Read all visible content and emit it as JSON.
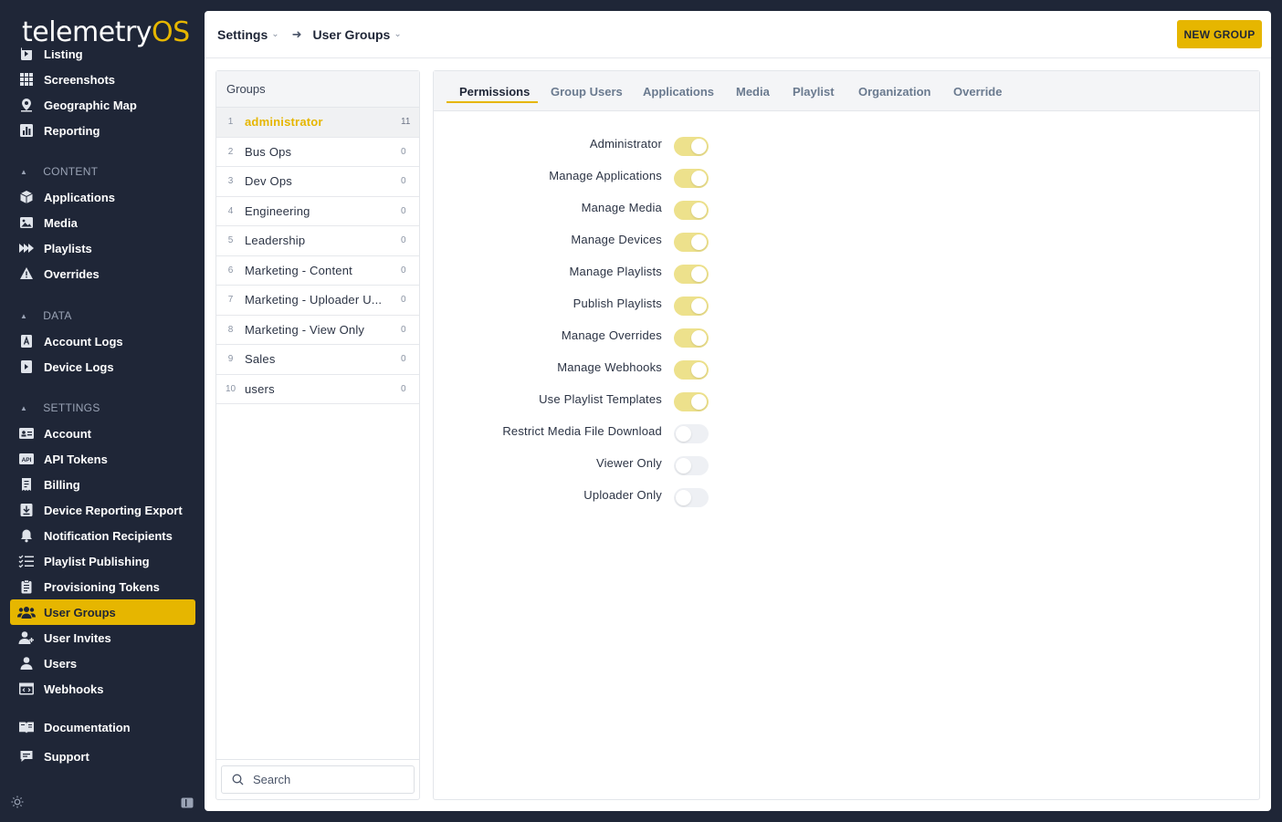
{
  "logo": {
    "text": "telemetry",
    "os": "OS"
  },
  "sidebar": {
    "partial_item": "Listing",
    "top_items": [
      {
        "label": "Screenshots",
        "icon": "grid-icon"
      },
      {
        "label": "Geographic Map",
        "icon": "map-pin-icon"
      },
      {
        "label": "Reporting",
        "icon": "chart-icon"
      }
    ],
    "sections": {
      "content": "CONTENT",
      "data": "DATA",
      "settings": "SETTINGS"
    },
    "content_items": [
      {
        "label": "Applications",
        "icon": "box-icon"
      },
      {
        "label": "Media",
        "icon": "image-icon"
      },
      {
        "label": "Playlists",
        "icon": "playlist-icon"
      },
      {
        "label": "Overrides",
        "icon": "warning-icon"
      }
    ],
    "data_items": [
      {
        "label": "Account Logs",
        "icon": "account-log-icon"
      },
      {
        "label": "Device Logs",
        "icon": "device-log-icon"
      }
    ],
    "settings_items": [
      {
        "label": "Account",
        "icon": "id-card-icon"
      },
      {
        "label": "API Tokens",
        "icon": "api-icon"
      },
      {
        "label": "Billing",
        "icon": "receipt-icon"
      },
      {
        "label": "Device Reporting Export",
        "icon": "download-icon"
      },
      {
        "label": "Notification Recipients",
        "icon": "bell-icon"
      },
      {
        "label": "Playlist Publishing",
        "icon": "checklist-icon"
      },
      {
        "label": "Provisioning Tokens",
        "icon": "clipboard-icon"
      },
      {
        "label": "User Groups",
        "icon": "users-icon"
      },
      {
        "label": "User Invites",
        "icon": "user-plus-icon"
      },
      {
        "label": "Users",
        "icon": "user-icon"
      },
      {
        "label": "Webhooks",
        "icon": "webhook-icon"
      }
    ],
    "footer_items": [
      {
        "label": "Documentation",
        "icon": "book-icon"
      },
      {
        "label": "Support",
        "icon": "chat-icon"
      }
    ],
    "active": "User Groups"
  },
  "topbar": {
    "crumb1": "Settings",
    "crumb2": "User Groups",
    "new_group": "NEW GROUP"
  },
  "groups": {
    "header": "Groups",
    "rows": [
      {
        "num": "1",
        "name": "administrator",
        "count": "11"
      },
      {
        "num": "2",
        "name": "Bus Ops",
        "count": "0"
      },
      {
        "num": "3",
        "name": "Dev Ops",
        "count": "0"
      },
      {
        "num": "4",
        "name": "Engineering",
        "count": "0"
      },
      {
        "num": "5",
        "name": "Leadership",
        "count": "0"
      },
      {
        "num": "6",
        "name": "Marketing - Content",
        "count": "0"
      },
      {
        "num": "7",
        "name": "Marketing - Uploader U...",
        "count": "0"
      },
      {
        "num": "8",
        "name": "Marketing - View Only",
        "count": "0"
      },
      {
        "num": "9",
        "name": "Sales",
        "count": "0"
      },
      {
        "num": "10",
        "name": "users",
        "count": "0"
      }
    ],
    "search_placeholder": "Search"
  },
  "tabs": [
    "Permissions",
    "Group Users",
    "Applications",
    "Media",
    "Playlist",
    "Organization",
    "Override"
  ],
  "permissions": [
    {
      "label": "Administrator",
      "on": true
    },
    {
      "label": "Manage Applications",
      "on": true
    },
    {
      "label": "Manage Media",
      "on": true
    },
    {
      "label": "Manage Devices",
      "on": true
    },
    {
      "label": "Manage Playlists",
      "on": true
    },
    {
      "label": "Publish Playlists",
      "on": true
    },
    {
      "label": "Manage Overrides",
      "on": true
    },
    {
      "label": "Manage Webhooks",
      "on": true
    },
    {
      "label": "Use Playlist Templates",
      "on": true
    },
    {
      "label": "Restrict Media File Download",
      "on": false
    },
    {
      "label": "Viewer Only",
      "on": false
    },
    {
      "label": "Uploader Only",
      "on": false
    }
  ],
  "colors": {
    "accent": "#e6b600",
    "sidebar": "#1f2637",
    "toggle_on": "#ede18c",
    "toggle_off": "#eef0f4"
  }
}
